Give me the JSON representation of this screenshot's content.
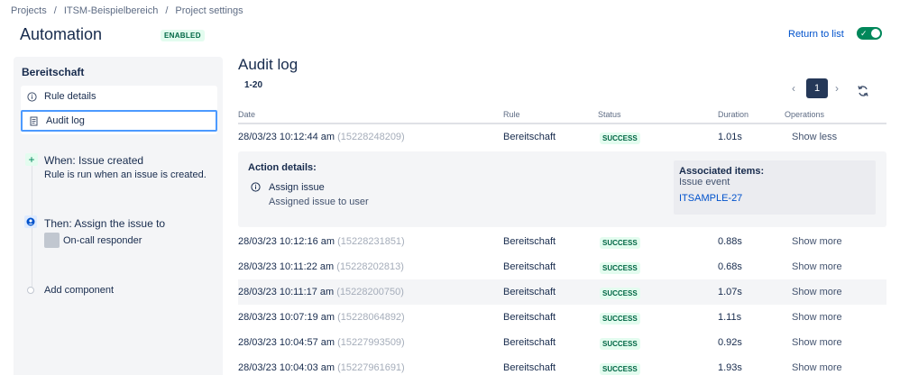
{
  "breadcrumb": [
    "Projects",
    "ITSM-Beispielbereich",
    "Project settings"
  ],
  "header": {
    "title": "Automation",
    "status_lozenge": "ENABLED",
    "return_link": "Return to list",
    "toggle_state": "on",
    "accent_color": "#00875a"
  },
  "sidebar": {
    "rule_name": "Bereitschaft",
    "nav": [
      {
        "label": "Rule details",
        "icon": "info-icon"
      },
      {
        "label": "Audit log",
        "icon": "document-icon",
        "active": true
      }
    ],
    "trigger": {
      "title": "When: Issue created",
      "description": "Rule is run when an issue is created."
    },
    "action": {
      "title": "Then: Assign the issue to",
      "assignee": "On-call responder"
    },
    "add_component": "Add component"
  },
  "main": {
    "title": "Audit log",
    "range": "1-20",
    "current_page": "1",
    "columns": [
      "Date",
      "Rule",
      "Status",
      "Duration",
      "Operations"
    ],
    "rows": [
      {
        "date": "28/03/23 10:12:44 am",
        "id": "(15228248209)",
        "rule": "Bereitschaft",
        "status": "SUCCESS",
        "duration": "1.01s",
        "operation": "Show less"
      },
      {
        "date": "28/03/23 10:12:16 am",
        "id": "(15228231851)",
        "rule": "Bereitschaft",
        "status": "SUCCESS",
        "duration": "0.88s",
        "operation": "Show more"
      },
      {
        "date": "28/03/23 10:11:22 am",
        "id": "(15228202813)",
        "rule": "Bereitschaft",
        "status": "SUCCESS",
        "duration": "0.68s",
        "operation": "Show more"
      },
      {
        "date": "28/03/23 10:11:17 am",
        "id": "(15228200750)",
        "rule": "Bereitschaft",
        "status": "SUCCESS",
        "duration": "1.07s",
        "operation": "Show more"
      },
      {
        "date": "28/03/23 10:07:19 am",
        "id": "(15228064892)",
        "rule": "Bereitschaft",
        "status": "SUCCESS",
        "duration": "1.11s",
        "operation": "Show more"
      },
      {
        "date": "28/03/23 10:04:57 am",
        "id": "(15227993509)",
        "rule": "Bereitschaft",
        "status": "SUCCESS",
        "duration": "0.92s",
        "operation": "Show more"
      },
      {
        "date": "28/03/23 10:04:03 am",
        "id": "(15227961691)",
        "rule": "Bereitschaft",
        "status": "SUCCESS",
        "duration": "1.93s",
        "operation": "Show more"
      }
    ],
    "details": {
      "label": "Action details:",
      "action_title": "Assign issue",
      "action_sub": "Assigned issue to user",
      "assoc_title": "Associated items:",
      "assoc_sub": "Issue event",
      "assoc_link": "ITSAMPLE-27"
    }
  }
}
